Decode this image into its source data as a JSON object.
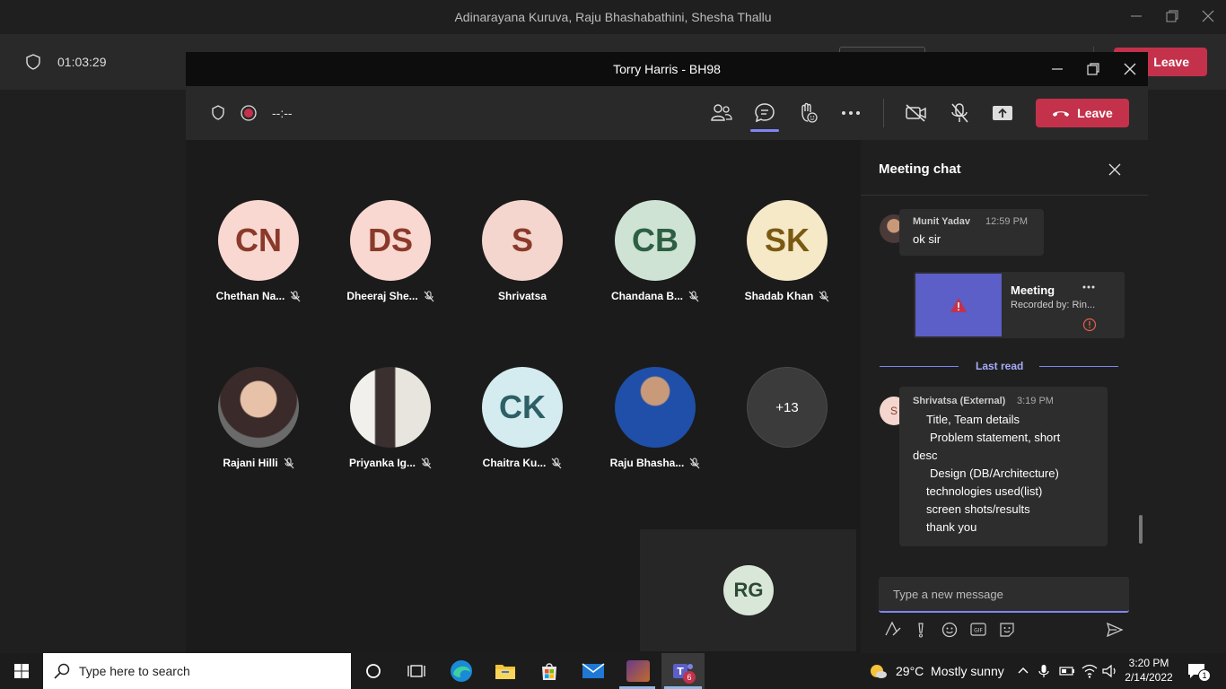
{
  "bg_window": {
    "title": "Adinarayana Kuruva, Raju Bhashabathini, Shesha Thallu",
    "timer": "01:03:29",
    "leave_label": "Leave"
  },
  "meeting": {
    "title": "Torry Harris - BH98",
    "timer": "--:--",
    "leave_label": "Leave",
    "accent": "#c4314b"
  },
  "participants": [
    {
      "initials": "CN",
      "name": "Chethan Na...",
      "bg": "#f9d8d1",
      "fg": "#8a3a2a"
    },
    {
      "initials": "DS",
      "name": "Dheeraj She...",
      "bg": "#f9d8d1",
      "fg": "#8a3a2a"
    },
    {
      "initials": "S",
      "name": "Shrivatsa",
      "bg": "#f4d6cf",
      "fg": "#8a3a2a"
    },
    {
      "initials": "CB",
      "name": "Chandana B...",
      "bg": "#cfe3d5",
      "fg": "#2d5f43"
    },
    {
      "initials": "SK",
      "name": "Shadab Khan",
      "bg": "#f6e9c8",
      "fg": "#7a5a12"
    },
    {
      "initials": "",
      "name": "Rajani Hilli",
      "bg": "#5a4a4a",
      "fg": "#fff"
    },
    {
      "initials": "",
      "name": "Priyanka Ig...",
      "bg": "#d8d6d2",
      "fg": "#fff"
    },
    {
      "initials": "CK",
      "name": "Chaitra Ku...",
      "bg": "#d4ecef",
      "fg": "#2c5f66"
    },
    {
      "initials": "",
      "name": "Raju Bhasha...",
      "bg": "#2d5fa8",
      "fg": "#fff"
    },
    {
      "initials": "+13",
      "name": "",
      "bg": "#3b3b3b",
      "fg": "#fff"
    }
  ],
  "self_tile": {
    "initials": "RG"
  },
  "chat": {
    "header": "Meeting chat",
    "msg1": {
      "author": "Munit Yadav",
      "time": "12:59 PM",
      "text": "ok sir"
    },
    "recording_card": {
      "title": "Meeting",
      "subtitle": "Recorded by: Rin..."
    },
    "last_read": "Last read",
    "msg2": {
      "avatar": "S",
      "author": "Shrivatsa (External)",
      "time": "3:19 PM",
      "lines": [
        "Title, Team details",
        "Problem statement, short",
        "desc",
        "Design (DB/Architecture)",
        "technologies used(list)",
        "screen shots/results",
        "thank you"
      ]
    },
    "input_placeholder": "Type a new message"
  },
  "taskbar": {
    "search_placeholder": "Type here to search",
    "weather": "29°C  Mostly sunny",
    "time": "3:20 PM",
    "date": "2/14/2022",
    "teams_badge": "6",
    "notif_count": "1"
  }
}
